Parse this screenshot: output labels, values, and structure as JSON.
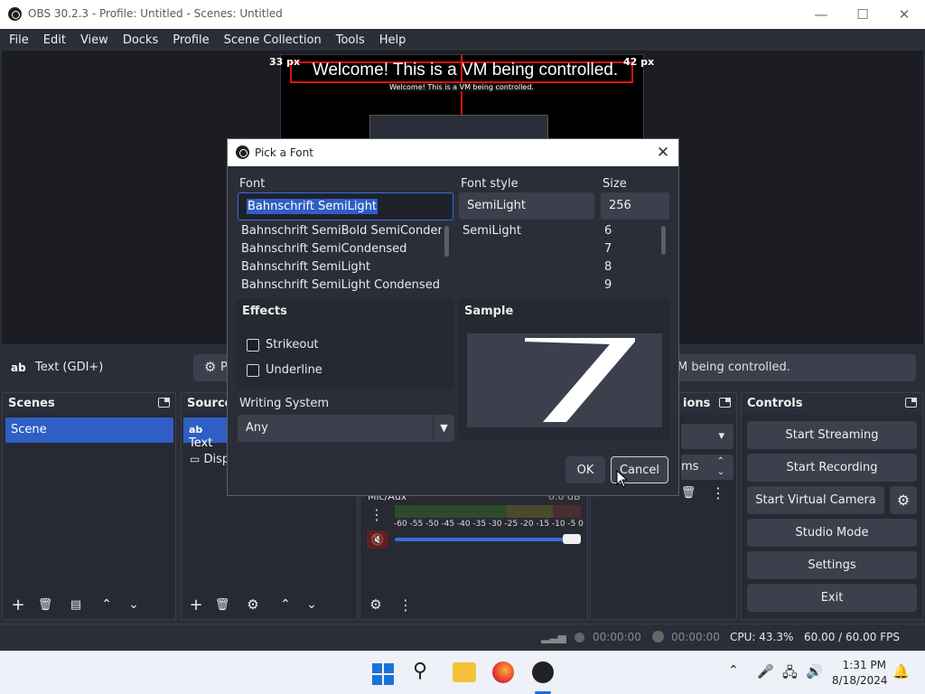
{
  "window": {
    "title": "OBS 30.2.3 - Profile: Untitled - Scenes: Untitled"
  },
  "menu": [
    "File",
    "Edit",
    "View",
    "Docks",
    "Profile",
    "Scene Collection",
    "Tools",
    "Help"
  ],
  "preview": {
    "main_text": "Welcome! This is a VM being controlled.",
    "left_px": "33 px",
    "right_px": "42 px",
    "nested_text": "Welcome! This is a VM being controlled."
  },
  "source_bar": {
    "type_label": "Text (GDI+)",
    "properties_partial": "P",
    "text_value_partial": "M being controlled."
  },
  "scenes": {
    "title": "Scenes",
    "items": [
      "Scene"
    ]
  },
  "sources": {
    "title": "Source",
    "items": [
      "Text",
      "Disp"
    ]
  },
  "mixer": {
    "track": "Mic/Aux",
    "db": "0.0 dB",
    "ticks": [
      "-60",
      "-55",
      "-50",
      "-45",
      "-40",
      "-35",
      "-30",
      "-25",
      "-20",
      "-15",
      "-10",
      "-5",
      "0"
    ]
  },
  "transitions": {
    "title_partial": "ions",
    "duration_partial": "ms"
  },
  "controls": {
    "title": "Controls",
    "start_streaming": "Start Streaming",
    "start_recording": "Start Recording",
    "start_virtual_camera": "Start Virtual Camera",
    "studio_mode": "Studio Mode",
    "settings": "Settings",
    "exit": "Exit"
  },
  "status": {
    "stream_time": "00:00:00",
    "record_time": "00:00:00",
    "cpu": "CPU: 43.3%",
    "fps": "60.00 / 60.00 FPS"
  },
  "dialog": {
    "title": "Pick a Font",
    "font_label": "Font",
    "font_value": "Bahnschrift SemiLight",
    "font_list": [
      "Bahnschrift SemiBold SemiConden",
      "Bahnschrift SemiCondensed",
      "Bahnschrift SemiLight",
      "Bahnschrift SemiLight Condensed"
    ],
    "style_label": "Font style",
    "style_value": "SemiLight",
    "style_list": [
      "SemiLight"
    ],
    "size_label": "Size",
    "size_value": "256",
    "size_list": [
      "6",
      "7",
      "8",
      "9"
    ],
    "effects_label": "Effects",
    "strikeout_label": "Strikeout",
    "underline_label": "Underline",
    "sample_label": "Sample",
    "writing_system_label": "Writing System",
    "writing_system_value": "Any",
    "ok_label": "OK",
    "cancel_label": "Cancel"
  },
  "taskbar": {
    "time": "1:31 PM",
    "date": "8/18/2024"
  }
}
